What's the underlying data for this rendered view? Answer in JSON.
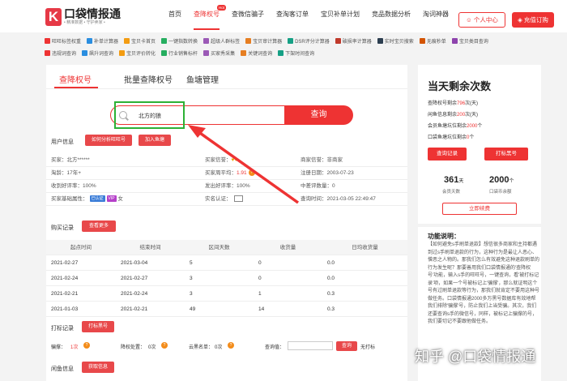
{
  "header": {
    "logo_text": "口袋情报通",
    "slogan": "• 精准数据 • 守护卖家 •",
    "nav": [
      {
        "label": "首页",
        "active": false
      },
      {
        "label": "查降权号",
        "active": true,
        "badge": "Hot"
      },
      {
        "label": "查微信骗子",
        "active": false
      },
      {
        "label": "查淘客订单",
        "active": false
      },
      {
        "label": "宝贝补单计划",
        "active": false
      },
      {
        "label": "竞品数据分析",
        "active": false
      },
      {
        "label": "淘词神器",
        "active": false
      }
    ],
    "user_center": "个人中心",
    "vip": "充值订购"
  },
  "tools": {
    "row1": [
      "旺旺标签权重",
      "补单计算器",
      "宝贝卡首页",
      "一键指数转换",
      "超级人群标签",
      "宝贝审计算器",
      "DSR评分计算器",
      "破损率计算器",
      "实时宝贝搜索",
      "无痕秒单",
      "宝贝类目查询"
    ],
    "row2": [
      "违规词查询",
      "飙升词查询",
      "宝贝评价转化",
      "行业销售标杆",
      "买家秀采集",
      "关键词查询",
      "下架时间查询"
    ]
  },
  "tabs": [
    {
      "label": "查降权号",
      "active": true
    },
    {
      "label": "批量查降权号",
      "active": false
    },
    {
      "label": "鱼塘管理",
      "active": false
    }
  ],
  "search": {
    "value": "北方的狼",
    "button": "查询"
  },
  "user_info": {
    "label": "用户信息",
    "btn_analyze": "如何分析旺旺号",
    "btn_pond": "加入鱼塘",
    "rows": [
      [
        {
          "k": "买家：",
          "v": "北方******"
        },
        {
          "k": "买家信誉：",
          "v": "1"
        },
        {
          "k": "商家信誉：",
          "v": "非商家"
        }
      ],
      [
        {
          "k": "淘龄：",
          "v": "17年+"
        },
        {
          "k": "买家周平均：",
          "v": "1.91"
        },
        {
          "k": "注册日期：",
          "v": "2003-07-23"
        }
      ],
      [
        {
          "k": "收到好评率：",
          "v": "100%"
        },
        {
          "k": "发出好评率：",
          "v": "100%"
        },
        {
          "k": "中差评数量：",
          "v": "0"
        }
      ],
      [
        {
          "k": "买家基础属性：",
          "v": "女"
        },
        {
          "k": "实名认证：",
          "v": ""
        },
        {
          "k": "查询时间：",
          "v": "2021-03-05 22:49:47"
        }
      ]
    ],
    "tags": [
      "已认证",
      "VIP"
    ]
  },
  "purchase": {
    "label": "购买记录",
    "btn_more": "查看更多",
    "columns": [
      "起点时间",
      "结束时间",
      "区间天数",
      "收货量",
      "日均收货量"
    ],
    "rows": [
      [
        "2021-02-27",
        "2021-03-04",
        "5",
        "0",
        "0.0"
      ],
      [
        "2021-02-24",
        "2021-02-27",
        "3",
        "0",
        "0.0"
      ],
      [
        "2021-02-21",
        "2021-02-24",
        "3",
        "1",
        "0.3"
      ],
      [
        "2021-01-03",
        "2021-02-21",
        "49",
        "14",
        "0.3"
      ]
    ]
  },
  "tagging": {
    "label": "打标记录",
    "btn": "打标黑号",
    "fields": [
      "骗撑：",
      "1次",
      "降权处置：",
      "0次",
      "云黑名单：",
      "0次",
      "查询值："
    ],
    "query_btn": "查询",
    "no_tag": "无打标"
  },
  "fish": {
    "label": "闲鱼信息",
    "btn": "获取信息"
  },
  "side": {
    "title": "当天剩余次数",
    "lines": [
      {
        "k": "查降权号剩余",
        "v": "796",
        "u": "次(天)"
      },
      {
        "k": "闲鱼信息剩余",
        "v": "200",
        "u": "次(天)"
      },
      {
        "k": "会员鱼塘坑位剩余",
        "v": "2000",
        "u": "个"
      },
      {
        "k": "口袋鱼塘坑位剩余",
        "v": "0",
        "u": "个"
      }
    ],
    "btn_record": "查询记录",
    "btn_black": "打标黑号",
    "stats": [
      {
        "num": "361",
        "unit": "天",
        "label": "会员天数"
      },
      {
        "num": "2000",
        "unit": "个",
        "label": "口袋币余额"
      }
    ],
    "renew": "立即续费"
  },
  "func": {
    "title": "功能说明：",
    "text": "【如何避免s手刷单退款】想信很多商家和主持都遇到过s手刷单退款的行为，这种行为是最让人恶心、憎恶之人物的。那我们怎么有效避免这种退款刷单的行为发生呢？那要善用我们口袋情报通的'查降权号'功能，输入s手的旺旺号，一键查询，看'被打标记录'项，如果一个号被标记上'骗撑'，那么就证明这个号有过刷单退款等行为，那我们就肯定不要用这种号做任务。口袋情报通2000多万黑号数据库有效地帮我们排除'骗撑'号，防止我们上当受骗。其次，我们还要查询s手的微信号，同样，被标记上骗撑的号，我们要切记不要跟他做任务。"
  },
  "watermark": "知乎 @口袋情报通"
}
